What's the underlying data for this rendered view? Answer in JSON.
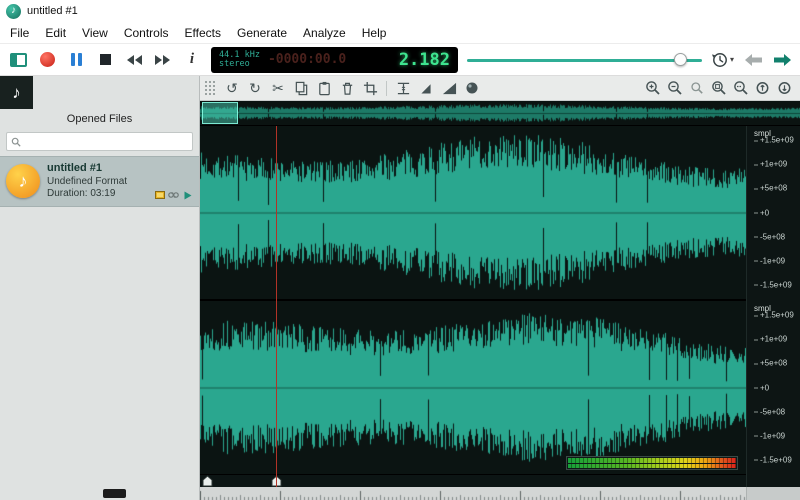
{
  "titlebar": {
    "title": "untitled #1"
  },
  "menu": [
    "File",
    "Edit",
    "View",
    "Controls",
    "Effects",
    "Generate",
    "Analyze",
    "Help"
  ],
  "lcd": {
    "sample_rate": "44.1 kHz",
    "channel_mode": "stereo",
    "time_dim": "-0000:00.0",
    "time_bright": "2.182"
  },
  "sidebar": {
    "header": "Opened Files",
    "search_value": "",
    "file": {
      "name": "untitled #1",
      "format": "Undefined Format",
      "duration": "Duration: 03:19"
    }
  },
  "waveform": {
    "scale_unit": "smpl",
    "scale_labels": [
      "+1.5e+09",
      "+1e+09",
      "+5e+08",
      "+0",
      "-5e+08",
      "-1e+09",
      "-1.5e+09"
    ],
    "channel_count": 2
  },
  "glyphs": {
    "note": "♪",
    "undo": "↺",
    "redo": "↻",
    "scissors": "✂",
    "fade": "◢",
    "caret": "▾",
    "info": "i"
  },
  "colors": {
    "wave": "#2aa78f",
    "wave_dim": "#1d7a67",
    "wave_bg": "#0b1412",
    "accent": "#1f8f7a",
    "lcd_green": "#3ee58f",
    "lcd_dim": "#4a211c",
    "record_red": "#d6281a",
    "pause_blue": "#2a7fd4",
    "cursor": "#b23327"
  }
}
